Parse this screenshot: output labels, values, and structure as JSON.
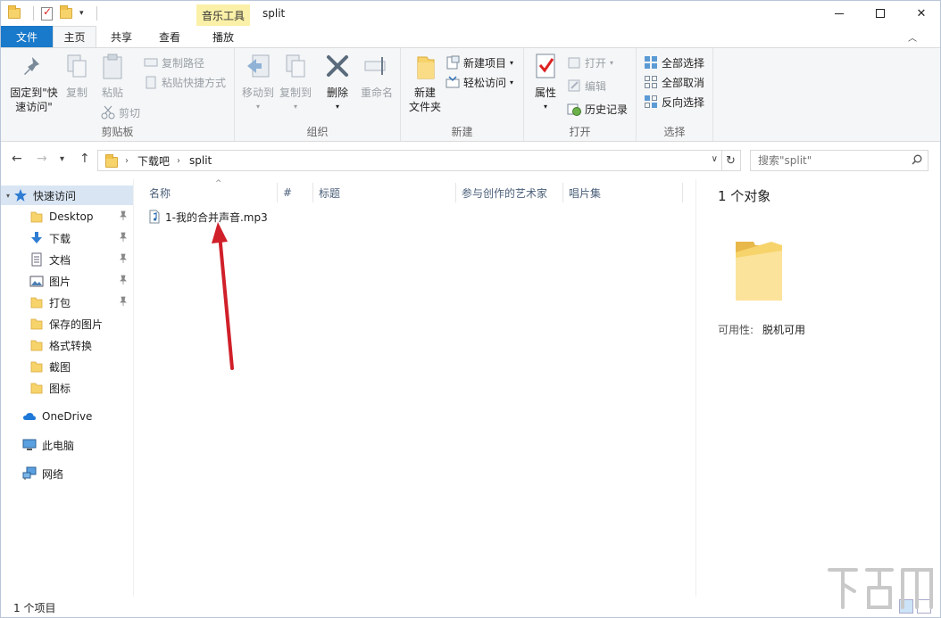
{
  "titlebar": {
    "context_tab": "音乐工具",
    "title": "split",
    "minimize_glyph": "",
    "maximize_glyph": "",
    "close_glyph": "✕"
  },
  "tabs": [
    {
      "label": "文件"
    },
    {
      "label": "主页"
    },
    {
      "label": "共享"
    },
    {
      "label": "查看"
    },
    {
      "label": "播放"
    }
  ],
  "ribbon": {
    "clipboard": {
      "label": "剪贴板",
      "pin_quick_line1": "固定到\"快",
      "pin_quick_line2": "速访问\"",
      "copy": "复制",
      "paste": "粘贴",
      "copy_path": "复制路径",
      "paste_shortcut": "粘贴快捷方式",
      "cut": "剪切"
    },
    "organize": {
      "label": "组织",
      "move_to": "移动到",
      "copy_to": "复制到",
      "delete": "删除",
      "rename": "重命名"
    },
    "new": {
      "label": "新建",
      "new_folder_line1": "新建",
      "new_folder_line2": "文件夹",
      "new_item": "新建项目",
      "easy_access": "轻松访问"
    },
    "open": {
      "label": "打开",
      "properties": "属性",
      "open": "打开",
      "edit": "编辑",
      "history": "历史记录"
    },
    "select": {
      "label": "选择",
      "select_all": "全部选择",
      "select_none": "全部取消",
      "invert": "反向选择"
    }
  },
  "address": {
    "crumbs": [
      "下载吧",
      "split"
    ],
    "search_placeholder": "搜索\"split\""
  },
  "nav": {
    "quick_access": "快速访问",
    "items": [
      {
        "label": "Desktop",
        "icon": "folder-icon",
        "pinned": true
      },
      {
        "label": "下载",
        "icon": "download-icon",
        "pinned": true
      },
      {
        "label": "文档",
        "icon": "document-icon",
        "pinned": true
      },
      {
        "label": "图片",
        "icon": "pictures-icon",
        "pinned": true
      },
      {
        "label": "打包",
        "icon": "folder-icon",
        "pinned": true
      },
      {
        "label": "保存的图片",
        "icon": "folder-icon",
        "pinned": false
      },
      {
        "label": "格式转换",
        "icon": "folder-icon",
        "pinned": false
      },
      {
        "label": "截图",
        "icon": "folder-icon",
        "pinned": false
      },
      {
        "label": "图标",
        "icon": "folder-icon",
        "pinned": false
      }
    ],
    "onedrive": "OneDrive",
    "this_pc": "此电脑",
    "network": "网络"
  },
  "columns": [
    "名称",
    "#",
    "标题",
    "参与创作的艺术家",
    "唱片集"
  ],
  "files": [
    {
      "name": "1-我的合并声音.mp3",
      "icon": "audio-file-icon"
    }
  ],
  "preview": {
    "count": "1 个对象",
    "availability_label": "可用性:",
    "availability_value": "脱机可用"
  },
  "status": {
    "text": "1 个项目"
  },
  "colors": {
    "accent": "#1979ca",
    "context_tab": "#fbf0a8",
    "selection": "#d9e5f3",
    "arrow": "#d0202a"
  }
}
